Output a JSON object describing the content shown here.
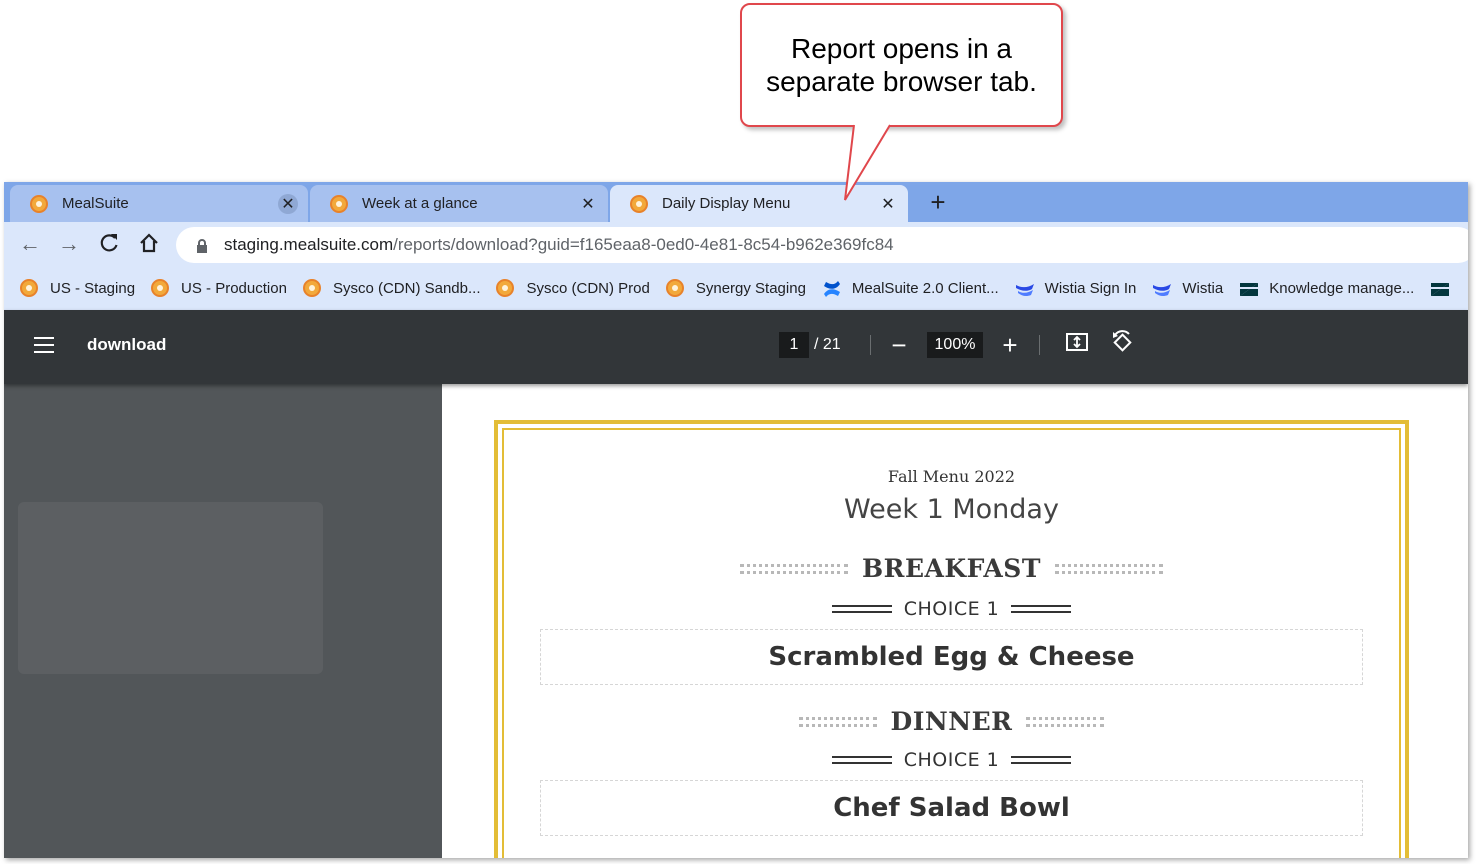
{
  "callout": {
    "text": "Report opens in a separate browser tab."
  },
  "tabs": [
    {
      "label": "MealSuite",
      "active": false
    },
    {
      "label": "Week at a glance",
      "active": false
    },
    {
      "label": "Daily Display Menu",
      "active": true
    }
  ],
  "new_tab_label": "+",
  "address": {
    "host": "staging.mealsuite.com",
    "path": "/reports/download?guid=f165eaa8-0ed0-4e81-8c54-b962e369fc84"
  },
  "bookmarks": [
    {
      "label": "US - Staging",
      "icon": "mealsuite-icon"
    },
    {
      "label": "US - Production",
      "icon": "mealsuite-icon"
    },
    {
      "label": "Sysco (CDN) Sandb...",
      "icon": "mealsuite-icon"
    },
    {
      "label": "Sysco (CDN) Prod",
      "icon": "mealsuite-icon"
    },
    {
      "label": "Synergy Staging",
      "icon": "mealsuite-icon"
    },
    {
      "label": "MealSuite 2.0 Client...",
      "icon": "confluence-icon"
    },
    {
      "label": "Wistia Sign In",
      "icon": "wistia-icon"
    },
    {
      "label": "Wistia",
      "icon": "wistia-icon"
    },
    {
      "label": "Knowledge manage...",
      "icon": "zendesk-icon"
    }
  ],
  "viewer": {
    "title": "download",
    "page_current": "1",
    "page_total": "/ 21",
    "zoom": "100%"
  },
  "document": {
    "subtitle": "Fall Menu 2022",
    "day": "Week 1 Monday",
    "meals": [
      {
        "title": "BREAKFAST",
        "choice": "CHOICE 1",
        "dish": "Scrambled Egg & Cheese"
      },
      {
        "title": "DINNER",
        "choice": "CHOICE 1",
        "dish": "Chef Salad Bowl"
      }
    ]
  },
  "colors": {
    "tabstrip": "#7ea6e8",
    "toolbar": "#dbe7fb",
    "viewer_bar": "#323639",
    "sidebar": "#525659",
    "page_border": "#e3bd36",
    "callout_border": "#e0474c"
  }
}
